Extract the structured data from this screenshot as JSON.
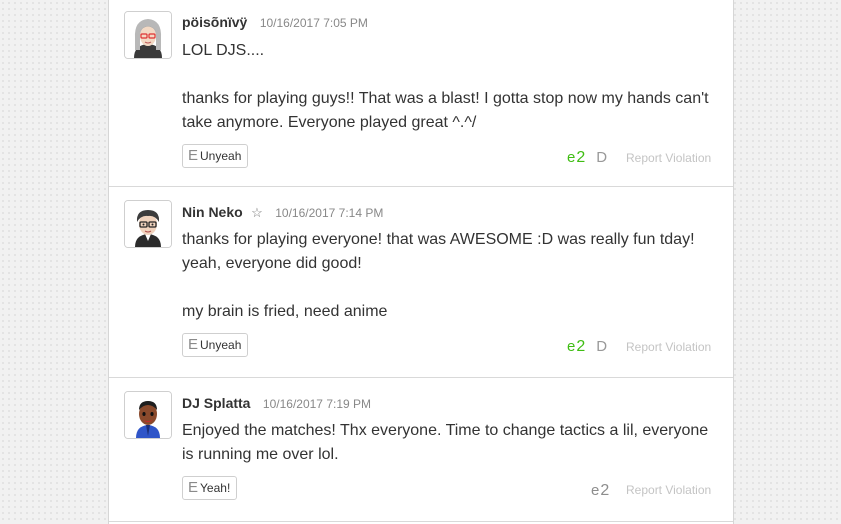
{
  "colors": {
    "empathy_active": "#3fbd13",
    "empathy_inactive": "#8d8d8d",
    "report_link": "#c4c4c4"
  },
  "icons": {
    "empathy": "E",
    "empathy_count": "e",
    "reply": "D"
  },
  "posts": [
    {
      "author": "pöisõnïvÿ",
      "starred": false,
      "timestamp": "10/16/2017 7:05 PM",
      "paragraphs": [
        "LOL DJS....",
        "thanks for playing guys!! That was a blast! I gotta stop now my hands can't take anymore. Everyone played great ^.^/"
      ],
      "empathy_label": "Unyeah",
      "empathy_count": "2",
      "empathized": true,
      "reply_icon": true,
      "report_label": "Report Violation"
    },
    {
      "author": "Nin Neko",
      "starred": true,
      "star_icon": "☆",
      "timestamp": "10/16/2017 7:14 PM",
      "paragraphs": [
        "thanks for playing everyone! that was AWESOME :D was really fun tday! yeah, everyone did good!",
        "my brain is fried, need anime"
      ],
      "empathy_label": "Unyeah",
      "empathy_count": "2",
      "empathized": true,
      "reply_icon": true,
      "report_label": "Report Violation"
    },
    {
      "author": "DJ Splatta",
      "starred": false,
      "timestamp": "10/16/2017 7:19 PM",
      "paragraphs": [
        "Enjoyed the matches! Thx everyone. Time to change tactics a lil, everyone is running me over lol."
      ],
      "empathy_label": "Yeah!",
      "empathy_count": "2",
      "empathized": false,
      "reply_icon": false,
      "report_label": "Report Violation"
    }
  ]
}
